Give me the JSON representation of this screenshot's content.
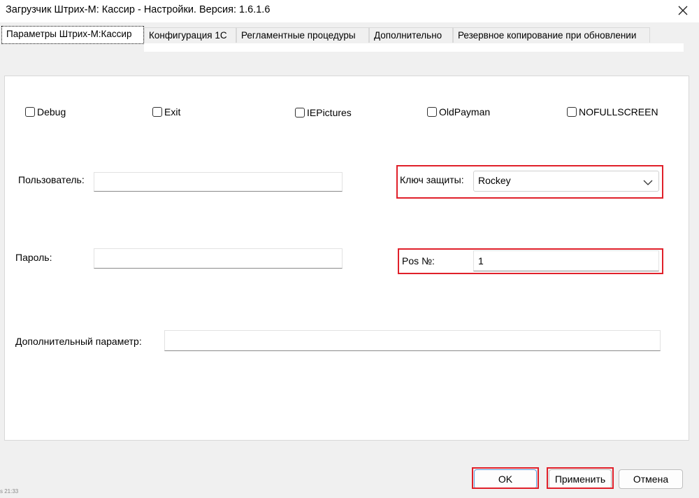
{
  "window": {
    "title": "Загрузчик Штрих-М: Кассир - Настройки. Версия: 1.6.1.6",
    "close_icon": "close-icon"
  },
  "tabs": [
    {
      "label": "Параметры Штрих-М:Кассир",
      "active": true
    },
    {
      "label": "Конфигурация 1С",
      "active": false
    },
    {
      "label": "Регламентные процедуры",
      "active": false
    },
    {
      "label": "Дополнительно",
      "active": false
    },
    {
      "label": "Резервное копирование при обновлении",
      "active": false
    }
  ],
  "checkboxes": [
    {
      "label": "Debug",
      "checked": false
    },
    {
      "label": "Exit",
      "checked": false
    },
    {
      "label": "IEPictures",
      "checked": false
    },
    {
      "label": "OldPayman",
      "checked": false
    },
    {
      "label": "NOFULLSCREEN",
      "checked": false
    }
  ],
  "fields": {
    "user_label": "Пользователь:",
    "user_value": "",
    "password_label": "Пароль:",
    "password_value": "",
    "key_label": "Ключ защиты:",
    "key_value": "Rockey",
    "pos_label": "Pos №:",
    "pos_value": "1",
    "extra_label": "Дополнительный  параметр:",
    "extra_value": ""
  },
  "buttons": {
    "ok": "OK",
    "apply": "Применить",
    "cancel": "Отмена"
  },
  "corner_text": "s 21:33",
  "colors": {
    "highlight": "#e0202a",
    "panel": "#ffffff",
    "window_bg": "#f0f0f0",
    "default_button_border": "#5a9ede"
  }
}
